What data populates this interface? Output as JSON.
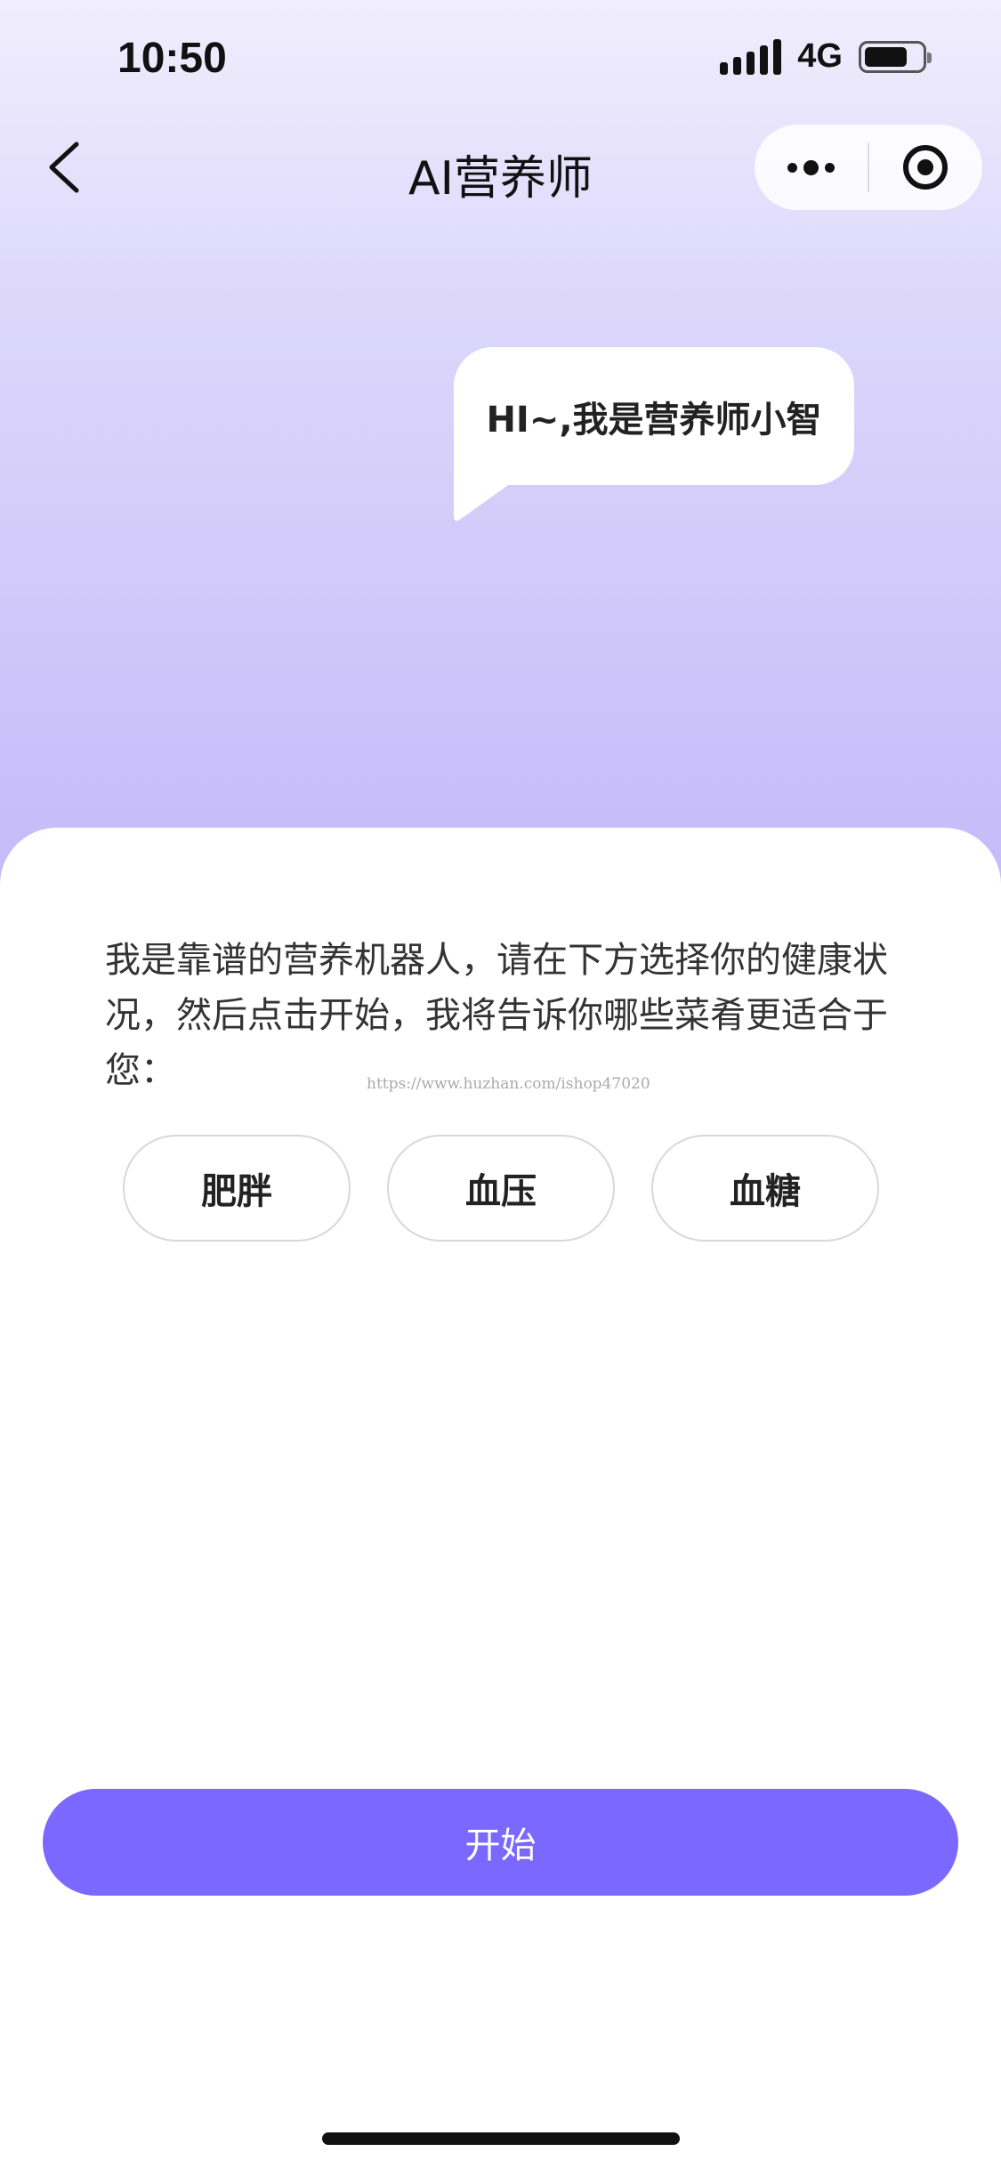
{
  "status_bar": {
    "time": "10:50",
    "network": "4G",
    "battery_level": 0.75
  },
  "nav": {
    "title": "AI营养师",
    "icons": {
      "back": "chevron-left-icon",
      "more": "more-dots-icon",
      "close": "target-circle-icon"
    }
  },
  "bubble": {
    "greeting": "HI~,我是营养师小智"
  },
  "content": {
    "intro": "我是靠谱的营养机器人，请在下方选择你的健康状况，然后点击开始，我将告诉你哪些菜肴更适合于您：",
    "watermark": "https://www.huzhan.com/ishop47020",
    "options": [
      "肥胖",
      "血压",
      "血糖"
    ]
  },
  "actions": {
    "start_label": "开始"
  },
  "colors": {
    "accent": "#7b68fe",
    "hero_top": "#f0eefd",
    "hero_bottom": "#c4baf9"
  }
}
